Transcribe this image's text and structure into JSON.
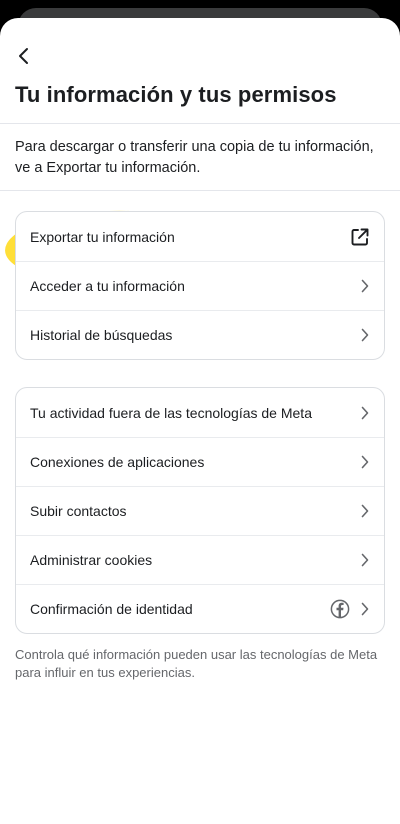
{
  "header": {
    "title": "Tu información y tus permisos",
    "back_icon": "chevron-left-icon"
  },
  "intro": "Para descargar o transferir una copia de tu información, ve a Exportar tu información.",
  "card1": [
    {
      "label": "Exportar tu información",
      "icon": "external-link-icon"
    },
    {
      "label": "Acceder a tu información",
      "icon": "chevron-right-icon"
    },
    {
      "label": "Historial de búsquedas",
      "icon": "chevron-right-icon"
    }
  ],
  "card2": [
    {
      "label": "Tu actividad fuera de las tecnologías de Meta",
      "icon": "chevron-right-icon"
    },
    {
      "label": "Conexiones de aplicaciones",
      "icon": "chevron-right-icon"
    },
    {
      "label": "Subir contactos",
      "icon": "chevron-right-icon"
    },
    {
      "label": "Administrar cookies",
      "icon": "chevron-right-icon"
    },
    {
      "label": "Confirmación de identidad",
      "icon": "chevron-right-icon",
      "extra_icon": "facebook-icon"
    }
  ],
  "footer": "Controla qué información pueden usar las tecnologías de Meta para influir en tus experiencias.",
  "colors": {
    "highlight": "#FFD600",
    "text": "#1c1e21",
    "secondary_text": "#65676b"
  }
}
